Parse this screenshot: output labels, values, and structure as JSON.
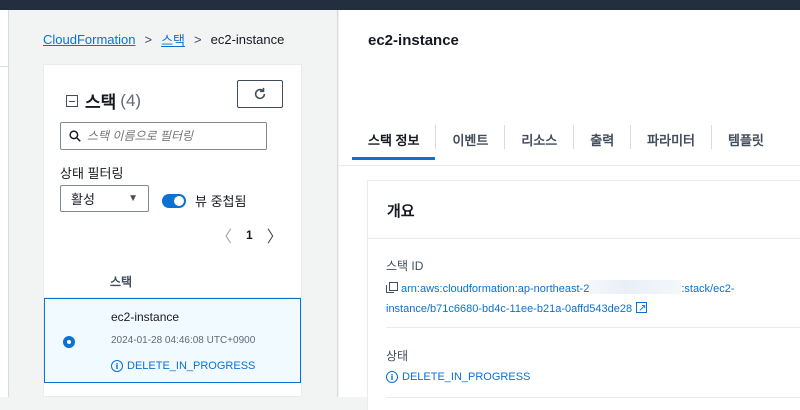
{
  "breadcrumb": {
    "items": [
      "CloudFormation",
      "스택",
      "ec2-instance"
    ],
    "separator": ">"
  },
  "stacks_panel": {
    "title": "스택",
    "count": "(4)",
    "refresh_icon": "refresh-icon",
    "search": {
      "placeholder": "스택 이름으로 필터링",
      "value": ""
    },
    "filter_label": "상태 필터링",
    "filter_select": {
      "value": "활성"
    },
    "toggle": {
      "label": "뷰 중첩됨",
      "on": true
    },
    "pager": {
      "prev": "<",
      "page": "1",
      "next": ">"
    },
    "table_header": "스택",
    "rows": [
      {
        "name": "ec2-instance",
        "created": "2024-01-28 04:46:08 UTC+0900",
        "status": "DELETE_IN_PROGRESS",
        "selected": true
      }
    ]
  },
  "detail": {
    "title": "ec2-instance",
    "tabs": [
      "스택 정보",
      "이벤트",
      "리소스",
      "출력",
      "파라미터",
      "템플릿"
    ],
    "active_tab": "스택 정보",
    "overview": {
      "heading": "개요",
      "stack_id_label": "스택 ID",
      "stack_id_part1": "arn:aws:cloudformation:ap-northeast-2",
      "stack_id_part2": ":stack/ec2-",
      "stack_id_part3": "instance/b71c6680-bd4c-11ee-b21a-0affd543de28",
      "status_label": "상태",
      "status_value": "DELETE_IN_PROGRESS"
    }
  },
  "colors": {
    "link": "#0972d3",
    "topbar": "#232f3e",
    "selected_row_bg": "#f1faff"
  }
}
